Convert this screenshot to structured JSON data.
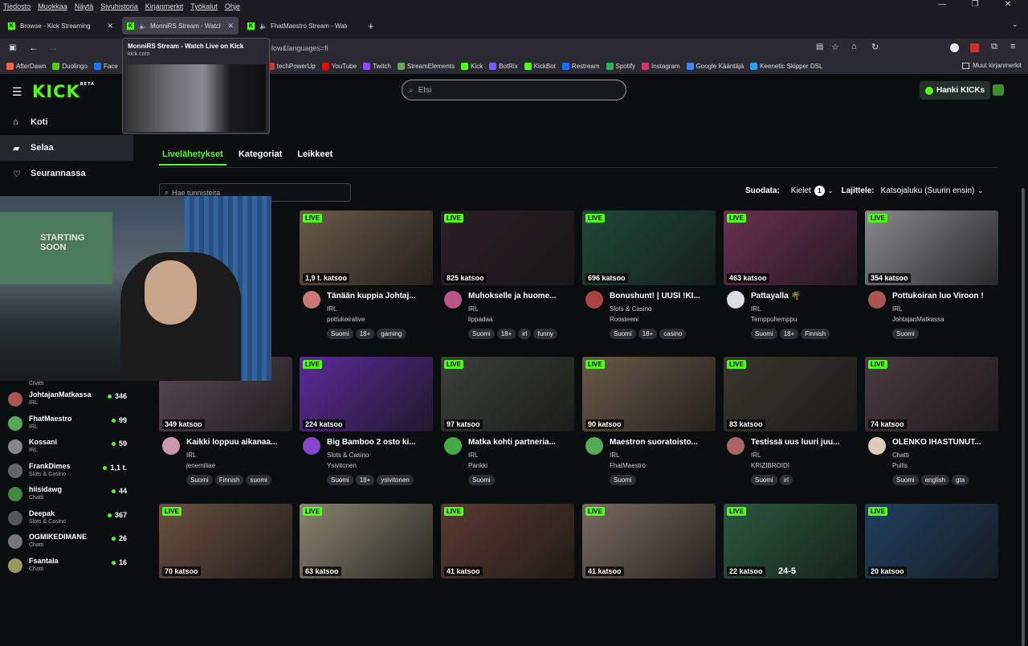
{
  "menubar": [
    "Tiedosto",
    "Muokkaa",
    "Näytä",
    "Sivuhistoria",
    "Kirjanmerkit",
    "Työkalut",
    "Ohje"
  ],
  "tabs": [
    {
      "label": "Browse - Kick Streaming",
      "active": false
    },
    {
      "label": "MonniRS Stream - Watch",
      "active": true
    },
    {
      "label": "FhatMaestro Stream - Watc",
      "active": false
    }
  ],
  "url_fragment": "low&languages=fi",
  "bookmarks": [
    {
      "label": "AfterDawn",
      "color": "#e64"
    },
    {
      "label": "Duolingo",
      "color": "#58cc02"
    },
    {
      "label": "Face",
      "color": "#1877f2"
    },
    {
      "label": "techPowerUp",
      "color": "#c33"
    },
    {
      "label": "YouTube",
      "color": "#f00"
    },
    {
      "label": "Twitch",
      "color": "#9146ff"
    },
    {
      "label": "StreamElements",
      "color": "#6a5"
    },
    {
      "label": "Kick",
      "color": "#53fc18"
    },
    {
      "label": "BotRix",
      "color": "#7b5cff"
    },
    {
      "label": "KickBot",
      "color": "#53fc18"
    },
    {
      "label": "Restream",
      "color": "#1e6bff"
    },
    {
      "label": "Spotify",
      "color": "#1db954"
    },
    {
      "label": "Instagram",
      "color": "#e1306c"
    },
    {
      "label": "Google Kääntäjä",
      "color": "#4285f4"
    },
    {
      "label": "Keenetic Skipper DSL",
      "color": "#2a9df4"
    }
  ],
  "bookmarks_other": "Muut kirjanmerkit",
  "tooltip": {
    "title": "MonniRS Stream - Watch Live on Kick",
    "host": "kick.com"
  },
  "kick": {
    "logo": "KICK",
    "beta": "BETA",
    "search_placeholder": "Etsi",
    "kicks_button": "Hanki KICKs",
    "accent": "#53fc18"
  },
  "nav": [
    {
      "label": "Koti",
      "icon": "home-icon"
    },
    {
      "label": "Selaa",
      "icon": "browse-icon"
    },
    {
      "label": "Seurannassa",
      "icon": "heart-icon"
    }
  ],
  "subtabs": [
    "Livelähetykset",
    "Kategoriat",
    "Leikkeet"
  ],
  "tag_search_placeholder": "Hae tunnisteita",
  "filters": {
    "filter_label": "Suodata:",
    "lang_label": "Kielet",
    "lang_count": "1",
    "sort_label": "Lajittele:",
    "sort_value": "Katsojaluku (Suurin ensin)"
  },
  "webcam": {
    "poster_text": "STARTING SOON"
  },
  "following_top_cat": "Chatti",
  "following": [
    {
      "name": "JohtajanMatkassa",
      "cat": "IRL",
      "viewers": "346",
      "color": "#a55"
    },
    {
      "name": "FhatMaestro",
      "cat": "IRL",
      "viewers": "99",
      "color": "#5a5"
    },
    {
      "name": "Kossani",
      "cat": "IRL",
      "viewers": "59",
      "color": "#888"
    },
    {
      "name": "FrankDimes",
      "cat": "Slots & Casino",
      "viewers": "1,1 t.",
      "color": "#666"
    },
    {
      "name": "hiisidawg",
      "cat": "Chatti",
      "viewers": "44",
      "color": "#484"
    },
    {
      "name": "Deepak",
      "cat": "Slots & Casino",
      "viewers": "367",
      "color": "#555"
    },
    {
      "name": "OGMIKEDIMANE",
      "cat": "Chatti",
      "viewers": "26",
      "color": "#777"
    },
    {
      "name": "Fsantala",
      "cat": "Chatti",
      "viewers": "16",
      "color": "#996"
    }
  ],
  "cards_row1": [
    {
      "viewers": "1,9 t. katsoo",
      "title": "Tänään kuppia Johtaj...",
      "cat": "IRL",
      "chan": "pottukoiralive",
      "tags": [
        "Suomi",
        "18+",
        "gaming"
      ],
      "bg": "#6b5a48",
      "av": "#c77"
    },
    {
      "viewers": "825 katsoo",
      "title": "Muhokselle ja huome...",
      "cat": "IRL",
      "chan": "iippadaa",
      "tags": [
        "Suomi",
        "18+",
        "irl",
        "funny"
      ],
      "bg": "#2a2025",
      "av": "#b58"
    },
    {
      "viewers": "696 katsoo",
      "title": "Bonushunt! | UUSI !KI...",
      "cat": "Slots & Casino",
      "chan": "Roosteeni",
      "tags": [
        "Suomi",
        "18+",
        "casino"
      ],
      "bg": "#1e4a3a",
      "av": "#a44"
    },
    {
      "viewers": "463 katsoo",
      "title": "Pattayalla 🌴",
      "cat": "IRL",
      "chan": "Temppuhemppu",
      "tags": [
        "Suomi",
        "18+",
        "Finnish"
      ],
      "bg": "#6a3050",
      "av": "#ddd"
    },
    {
      "viewers": "354 katsoo",
      "title": "Pottukoiran luo Viroon !",
      "cat": "IRL",
      "chan": "JohtajanMatkassa",
      "tags": [
        "Suomi"
      ],
      "bg": "#8a8a8e",
      "av": "#a55"
    }
  ],
  "cards_row2": [
    {
      "viewers": "349 katsoo",
      "title": "Kaikki loppuu aikanaa...",
      "cat": "IRL",
      "chan": "jenemiliae",
      "tags": [
        "Suomi",
        "Finnish",
        "suomi"
      ],
      "bg": "#5a4a52",
      "av": "#c9a"
    },
    {
      "viewers": "224 katsoo",
      "title": "Big Bamboo 2 osto ki...",
      "cat": "Slots & Casino",
      "chan": "Ysivitonen",
      "tags": [
        "Suomi",
        "18+",
        "ysivitonen"
      ],
      "bg": "#5b2a9a",
      "av": "#84c"
    },
    {
      "viewers": "97 katsoo",
      "title": "Matka kohti partneria...",
      "cat": "IRL",
      "chan": "Pankki",
      "tags": [
        "Suomi"
      ],
      "bg": "#3c3f3a",
      "av": "#4a4"
    },
    {
      "viewers": "90 katsoo",
      "title": "Maestron suoratoisto...",
      "cat": "IRL",
      "chan": "FhatMaestro",
      "tags": [
        "Suomi"
      ],
      "bg": "#6a5a48",
      "av": "#5a5"
    },
    {
      "viewers": "83 katsoo",
      "title": "Testissä uus luuri juu...",
      "cat": "IRL",
      "chan": "KRIZIBROIDI",
      "tags": [
        "Suomi",
        "irl"
      ],
      "bg": "#3a3630",
      "av": "#a66"
    },
    {
      "viewers": "74 katsoo",
      "title": "OLENKO IHASTUNUT...",
      "cat": "Chatti",
      "chan": "Pullis",
      "tags": [
        "Suomi",
        "english",
        "gta"
      ],
      "bg": "#4a3a40",
      "av": "#dcb"
    }
  ],
  "cards_row3": [
    {
      "viewers": "70 katsoo",
      "bg": "#6a5040"
    },
    {
      "viewers": "63 katsoo",
      "bg": "#8a8570"
    },
    {
      "viewers": "41 katsoo",
      "bg": "#5a3a30"
    },
    {
      "viewers": "41 katsoo",
      "bg": "#7a6a60"
    },
    {
      "viewers": "22 katsoo",
      "bg": "#2a5a40",
      "extra": "24-5"
    },
    {
      "viewers": "20 katsoo",
      "bg": "#204060"
    }
  ]
}
